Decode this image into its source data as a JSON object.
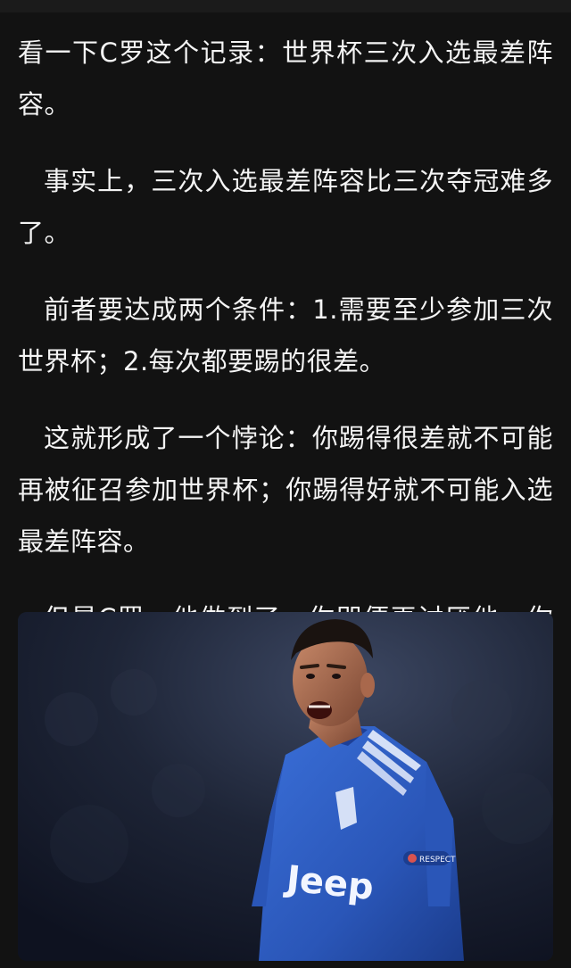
{
  "article": {
    "paragraphs": [
      "看一下C罗这个记录：世界杯三次入选最差阵容。",
      "事实上，三次入选最差阵容比三次夺冠难多了。",
      "前者要达成两个条件：1.需要至少参加三次世界杯；2.每次都要踢的很差。",
      "这就形成了一个悖论：你踢得很差就不可能再被征召参加世界杯；你踢得好就不可能入选最差阵容。",
      "但是C罗，他做到了，你即便再讨厌他，你也不得不服。"
    ]
  },
  "photo": {
    "jersey_sponsor": "Jeep",
    "sleeve_patch": "RESPECT",
    "colors": {
      "jersey": "#2f5fc8",
      "jersey_dark": "#1d3f96",
      "stripe": "#e8eefc",
      "background": "#1a2030"
    }
  }
}
